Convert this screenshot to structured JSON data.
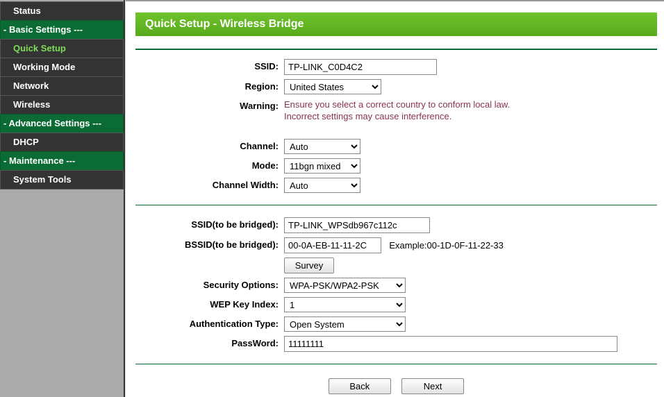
{
  "sidebar": {
    "status": "Status",
    "basic_settings": "- Basic Settings ---",
    "quick_setup": "Quick Setup",
    "working_mode": "Working Mode",
    "network": "Network",
    "wireless": "Wireless",
    "advanced_settings": "- Advanced Settings ---",
    "dhcp": "DHCP",
    "maintenance": "- Maintenance ---",
    "system_tools": "System Tools"
  },
  "page": {
    "title": "Quick Setup - Wireless Bridge"
  },
  "labels": {
    "ssid": "SSID:",
    "region": "Region:",
    "warning": "Warning:",
    "channel": "Channel:",
    "mode": "Mode:",
    "channel_width": "Channel Width:",
    "ssid_bridged": "SSID(to be bridged):",
    "bssid_bridged": "BSSID(to be bridged):",
    "security_options": "Security Options:",
    "wep_index": "WEP Key Index:",
    "auth_type": "Authentication Type:",
    "password": "PassWord:"
  },
  "values": {
    "ssid": "TP-LINK_C0D4C2",
    "region": "United States",
    "warning_line1": "Ensure you select a correct country to conform local law.",
    "warning_line2": "Incorrect settings may cause interference.",
    "channel": "Auto",
    "mode": "11bgn mixed",
    "channel_width": "Auto",
    "ssid_bridged": "TP-LINK_WPSdb967c112c",
    "bssid_bridged": "00-0A-EB-11-11-2C",
    "example": "Example:00-1D-0F-11-22-33",
    "survey": "Survey",
    "security_options": "WPA-PSK/WPA2-PSK",
    "wep_index": "1",
    "auth_type": "Open System",
    "password": "11111111",
    "back": "Back",
    "next": "Next"
  }
}
